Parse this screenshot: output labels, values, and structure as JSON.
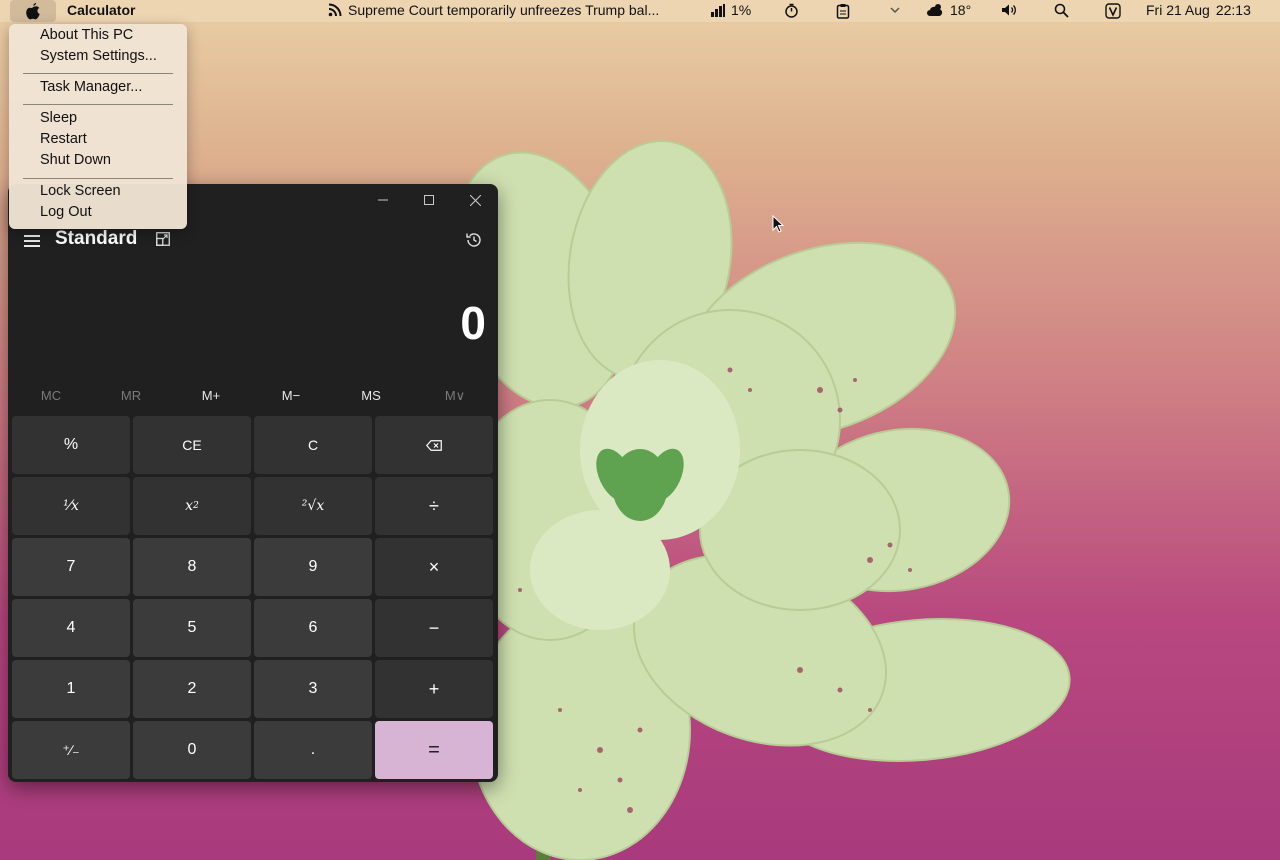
{
  "menubar": {
    "app_name": "Calculator",
    "news": "Supreme Court temporarily unfreezes Trump bal...",
    "battery": "1%",
    "weather": "18°",
    "date": "Fri 21 Aug",
    "time": "22:13",
    "icons": [
      "apple-logo-icon",
      "rss-icon",
      "signal-bars-icon",
      "timer-icon",
      "clipboard-icon",
      "chevron-down-icon",
      "weather-icon",
      "volume-icon",
      "search-icon",
      "v-app-icon"
    ]
  },
  "apple_menu": {
    "items": [
      "About This PC",
      "System Settings...",
      "Task Manager...",
      "Sleep",
      "Restart",
      "Shut Down",
      "Lock Screen",
      "Log Out"
    ]
  },
  "calculator": {
    "mode": "Standard",
    "display": "0",
    "memory": [
      "MC",
      "MR",
      "M+",
      "M−",
      "MS",
      "M∨"
    ],
    "keys": {
      "percent": "%",
      "ce": "CE",
      "c": "C",
      "backspace": "⌫",
      "reciprocal": "¹⁄x",
      "square_base": "x",
      "square_exp": "2",
      "sqrt": "²√x",
      "divide": "÷",
      "seven": "7",
      "eight": "8",
      "nine": "9",
      "multiply": "×",
      "four": "4",
      "five": "5",
      "six": "6",
      "minus": "−",
      "one": "1",
      "two": "2",
      "three": "3",
      "plus": "+",
      "negate": "⁺∕₋",
      "zero": "0",
      "decimal": ".",
      "equals": "="
    },
    "accent": "#d7b4d3"
  }
}
